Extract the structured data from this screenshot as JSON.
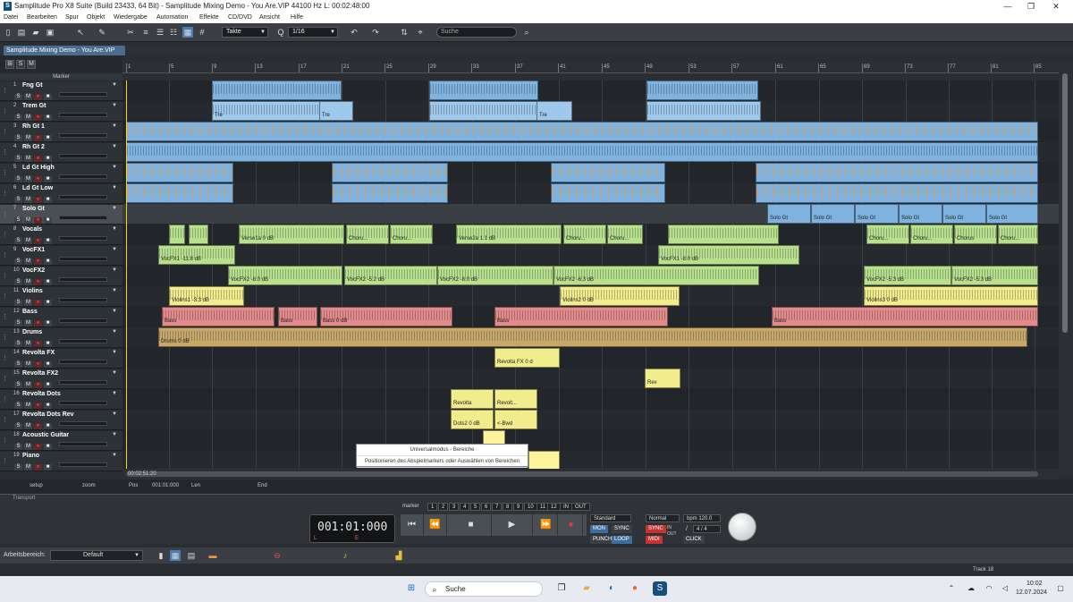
{
  "window": {
    "title": "Samplitude Pro X8 Suite (Build 23433, 64 Bit)  -  Samplitude Mixing Demo - You Are.VIP  44100 Hz L: 00:02:48:00",
    "minimize": "—",
    "maximize": "❐",
    "close": "✕"
  },
  "menu": [
    "Datei",
    "Bearbeiten",
    "Spur",
    "Objekt",
    "Wiedergabe",
    "Automation",
    "Effekte",
    "CD/DVD",
    "Ansicht",
    "Hilfe"
  ],
  "toolbar": {
    "unit_select": "Takte",
    "grid_select": "1/16",
    "search_placeholder": "Suche"
  },
  "project_tab": "Samplitude Mixing Demo - You Are.VIP",
  "track_header": {
    "marker_label": "Marker",
    "collapse": "⊞",
    "solo": "S",
    "mute": "M"
  },
  "ruler": [
    "1",
    "5",
    "9",
    "13",
    "17",
    "21",
    "25",
    "29",
    "33",
    "37",
    "41",
    "45",
    "49",
    "53",
    "57",
    "61",
    "65",
    "69",
    "73",
    "77",
    "81",
    "85"
  ],
  "tracks": [
    {
      "num": "1",
      "name": "Fng Gt"
    },
    {
      "num": "2",
      "name": "Trem Gt"
    },
    {
      "num": "3",
      "name": "Rh Gt 1"
    },
    {
      "num": "4",
      "name": "Rh Gt 2"
    },
    {
      "num": "5",
      "name": "Ld Gt High"
    },
    {
      "num": "6",
      "name": "Ld Gt Low"
    },
    {
      "num": "7",
      "name": "Solo Gt"
    },
    {
      "num": "8",
      "name": "Vocals"
    },
    {
      "num": "9",
      "name": "VocFX1"
    },
    {
      "num": "10",
      "name": "VocFX2"
    },
    {
      "num": "11",
      "name": "Violins"
    },
    {
      "num": "12",
      "name": "Bass"
    },
    {
      "num": "13",
      "name": "Drums"
    },
    {
      "num": "14",
      "name": "Revolta FX"
    },
    {
      "num": "15",
      "name": "Revolta FX2"
    },
    {
      "num": "16",
      "name": "Revolta Dots"
    },
    {
      "num": "17",
      "name": "Revolta Dots Rev"
    },
    {
      "num": "18",
      "name": "Acoustic Guitar"
    },
    {
      "num": "19",
      "name": "Piano"
    }
  ],
  "track_buttons": {
    "solo": "S",
    "mute": "M",
    "record": "●",
    "monitor": "■"
  },
  "clip_labels": {
    "trem": "Tre",
    "solo": "Solo Gt",
    "verse1": "Verse1a  0 dB",
    "verse2": "Verse2a  1.1 dB",
    "choru": "Choru...",
    "choru_a": "Chorus",
    "vocfx1a": "VocFX1  -11.8 dB",
    "vocfx1b": "VocFX1  -8.0 dB",
    "vocfx2a": "VocFX2  -8.0 dB",
    "vocfx2b": "VocFX2  -5.2 dB",
    "vocfx2c": "VocFX2  -8.0 dB",
    "vocfx2d": "VocFX2  -6.3 dB",
    "vocfx2e": "VocFX2  -5.3 dB",
    "vocfx2f": "VocFX2  -5.3 dB",
    "violins1": "Violins1  -3.3 dB",
    "violins2": "Violins2  0 dB",
    "violins3": "Violins3  0 dB",
    "bass": "Bass",
    "bass2": "Bass  0 dB",
    "drums": "Drums  0 dB",
    "revfx": "Revolta FX  0 d",
    "rev": "Rev",
    "revolta": "Revolta",
    "revolta2": "Revolt...",
    "dots": "Dots2  0 dB",
    "bwd": "<-Bwd"
  },
  "hint": {
    "title": "Universalmodus - Bereiche",
    "text": "Positionieren des Abspielmarkers oder Auswählen von Bereichen"
  },
  "footer": {
    "timecode": "00:02:51:20",
    "setup": "setup",
    "zoom": "zoom",
    "pos_label": "Pos",
    "pos_value": "001:01:000",
    "len_label": "Len",
    "end_label": "End"
  },
  "transport": {
    "label": "Transport",
    "time": "001:01:000",
    "L": "L",
    "E": "E",
    "marker": "marker",
    "marker_nums": [
      "1",
      "2",
      "3",
      "4",
      "5",
      "6",
      "7",
      "8",
      "9",
      "10",
      "11",
      "12"
    ],
    "IN": "IN",
    "OUT": "OUT",
    "mode": "Standard",
    "mon": "MON",
    "sync": "SYNC",
    "punch": "PUNCH",
    "loop": "LOOP",
    "speed": "Normal",
    "bpm": "bpm 120.0",
    "sig": "4 / 4",
    "click": "CLICK",
    "sync2": "SYNC",
    "midi": "MIDI",
    "in": "IN",
    "out": "OUT",
    "slash": "/"
  },
  "workspace": {
    "label": "Arbeitsbereich:",
    "value": "Default"
  },
  "status": {
    "track": "Track 18"
  },
  "taskbar": {
    "search": "Suche",
    "time": "10:02",
    "date": "12.07.2024"
  },
  "colors": {
    "audio_blue": "#7fb2de",
    "vocals_green": "#b8e08c",
    "violins_yellow": "#f1ec8c",
    "bass_red": "#e48a8a",
    "drums_tan": "#c8a868",
    "playhead": "#ffd400"
  }
}
